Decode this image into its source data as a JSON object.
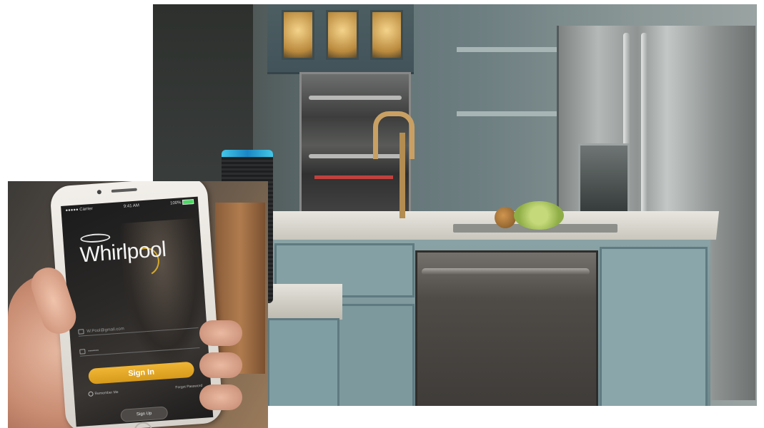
{
  "phone": {
    "status_carrier": "●●●●● Carrier",
    "status_time": "9:41 AM",
    "status_battery": "100%",
    "logo_text": "Whirlpool",
    "username_placeholder": "W.Pool@gmail.com",
    "password_value": "•••••••",
    "signin_label": "Sign In",
    "remember_label": "Remember Me",
    "forgot_label": "Forgot Password",
    "signup_label": "Sign Up"
  },
  "colors": {
    "accent": "#e3a72a",
    "speaker_ring": "#2fb4e0"
  }
}
